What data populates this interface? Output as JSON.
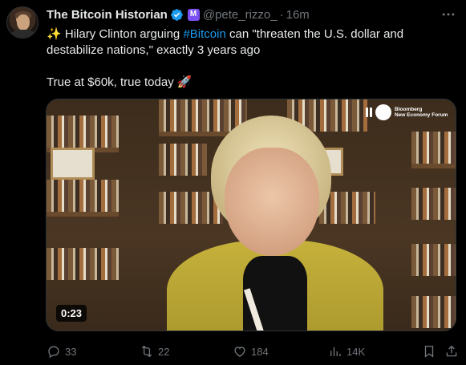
{
  "author": {
    "display_name": "The Bitcoin Historian",
    "handle": "@pete_rizzo_",
    "separator": "·",
    "time": "16m"
  },
  "tweet": {
    "line1_emoji": "✨",
    "line1_pre": " Hilary Clinton arguing ",
    "hashtag": "#Bitcoin",
    "line1_post": " can \"threaten the U.S. dollar and destabilize nations,\" exactly 3 years ago",
    "line2": "True at $60k, true today ",
    "line2_emoji": "🚀"
  },
  "media": {
    "watermark_line1": "Bloomberg",
    "watermark_line2": "New Economy Forum",
    "duration": "0:23"
  },
  "actions": {
    "replies": "33",
    "reposts": "22",
    "likes": "184",
    "views": "14K"
  },
  "icons": {
    "verified": "verified-badge-icon",
    "affiliate": "affiliate-badge-icon",
    "more": "more-icon",
    "reply": "reply-icon",
    "repost": "repost-icon",
    "like": "like-icon",
    "views": "views-icon",
    "bookmark": "bookmark-icon",
    "share": "share-icon"
  },
  "colors": {
    "background": "#000000",
    "text": "#e7e9ea",
    "muted": "#71767b",
    "link": "#1d9bf0",
    "verified": "#1d9bf0",
    "affiliate_badge": "#7b4ff0"
  }
}
